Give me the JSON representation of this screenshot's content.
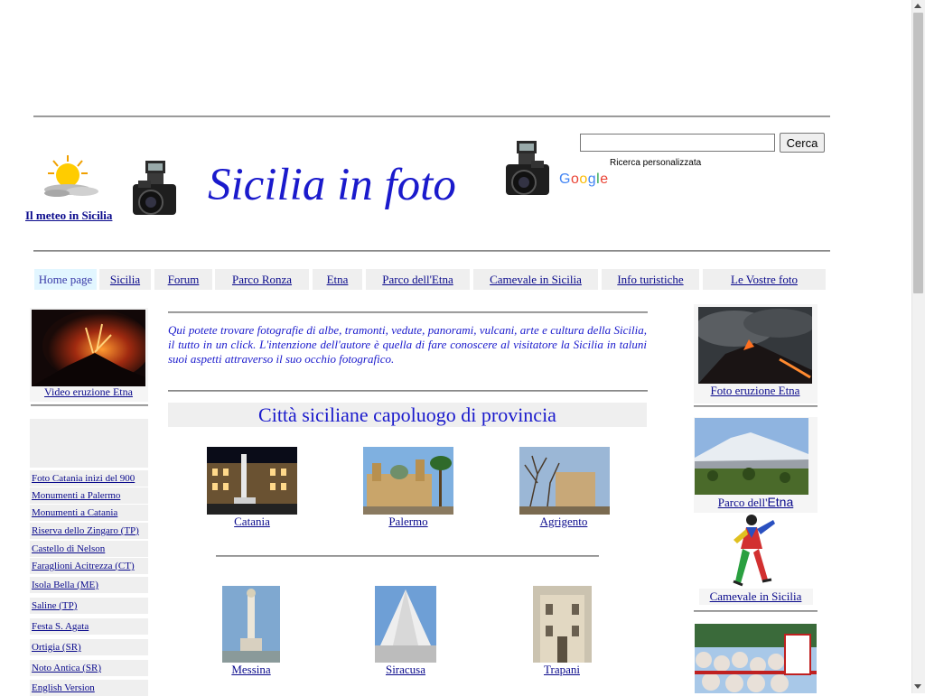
{
  "header": {
    "title": "Sicilia in foto",
    "meteo_link": "Il meteo in Sicilia",
    "search": {
      "button": "Cerca",
      "caption": "Ricerca personalizzata",
      "brand": "Google"
    }
  },
  "nav": [
    {
      "label": "Home page"
    },
    {
      "label": "Sicilia"
    },
    {
      "label": "Forum"
    },
    {
      "label": "Parco Ronza"
    },
    {
      "label": "Etna"
    },
    {
      "label": "Parco dell'Etna"
    },
    {
      "label": "Camevale in Sicilia"
    },
    {
      "label": "Info turistiche"
    },
    {
      "label": "Le Vostre foto"
    }
  ],
  "left": {
    "video_caption": "Video eruzione Etna",
    "links": [
      "Foto Catania inizi del 900",
      "Monumenti a Palermo",
      "Monumenti a Catania",
      "Riserva dello Zingaro (TP)",
      "Castello di Nelson",
      "Faraglioni Acitrezza (CT)",
      "Isola Bella (ME)",
      "Saline (TP)",
      "Festa S. Agata",
      "Ortigia (SR)",
      "Noto Antica (SR)",
      "English Version"
    ]
  },
  "main": {
    "intro": "Qui potete trovare fotografie di albe, tramonti, vedute, panorami, vulcani, arte e cultura della Sicilia, il tutto in un click. L'intenzione dell'autore è quella di fare conoscere al visitatore la Sicilia  in taluni suoi aspetti attraverso il suo occhio fotografico.",
    "section_title": "Città siciliane  capoluogo di provincia",
    "cities": [
      "Catania",
      "Palermo",
      "Agrigento",
      "Messina",
      "Siracusa",
      "Trapani"
    ]
  },
  "right": {
    "eruption_caption": "Foto eruzione Etna",
    "parco_caption_a": "Parco dell'",
    "parco_caption_b": "Etna",
    "carnevale_caption": "Camevale in Sicilia"
  }
}
